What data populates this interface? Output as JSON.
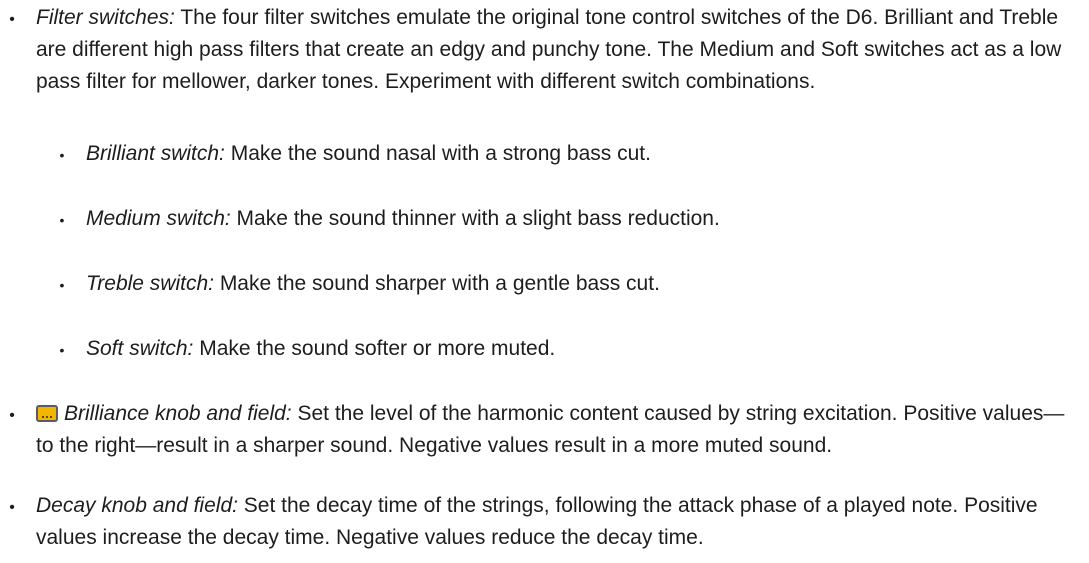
{
  "items": [
    {
      "term": "Filter switches:",
      "text": " The four filter switches emulate the original tone control switches of the D6. Brilliant and Treble are different high pass filters that create an edgy and punchy tone. The Medium and Soft switches act as a low pass filter for mellower, darker tones. Experiment with different switch combinations.",
      "subitems": [
        {
          "term": "Brilliant switch:",
          "text": " Make the sound nasal with a strong bass cut."
        },
        {
          "term": "Medium switch:",
          "text": " Make the sound thinner with a slight bass reduction."
        },
        {
          "term": "Treble switch:",
          "text": " Make the sound sharper with a gentle bass cut."
        },
        {
          "term": "Soft switch:",
          "text": " Make the sound softer or more muted."
        }
      ]
    },
    {
      "icon": "knob-badge-icon",
      "term": "Brilliance knob and field:",
      "text": " Set the level of the harmonic content caused by string excitation. Positive values—to the right—result in a sharper sound. Negative values result in a more muted sound."
    },
    {
      "term": "Decay knob and field:",
      "text": " Set the decay time of the strings, following the attack phase of a played note. Positive values increase the decay time. Negative values reduce the decay time."
    }
  ]
}
